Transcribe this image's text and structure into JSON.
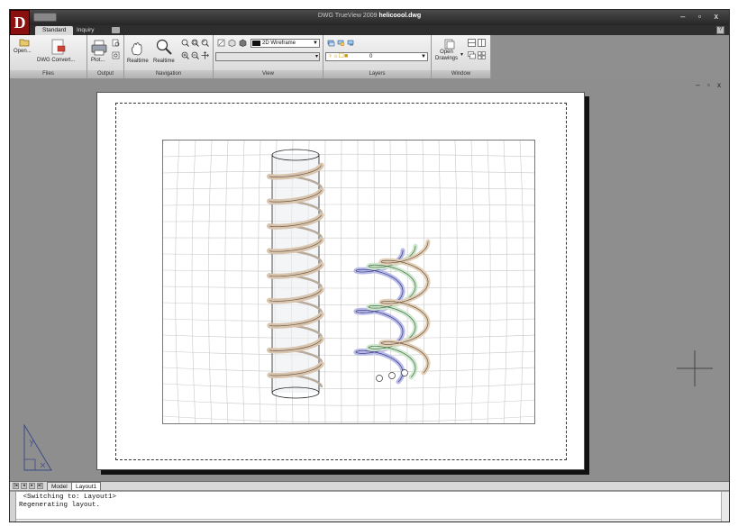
{
  "window": {
    "title_prefix": "DWG TrueView 2009 ",
    "title_file": "helicoool.dwg",
    "app_logo": "D",
    "controls": "– ▫ x"
  },
  "ribbon_tabs": [
    {
      "label": "Standard",
      "active": true
    },
    {
      "label": "Inquiry",
      "active": false
    }
  ],
  "help_label": "?",
  "ribbon": {
    "files": {
      "title": "Files",
      "open_label": "Open...",
      "convert_label": "DWG Convert..."
    },
    "output": {
      "title": "Output",
      "plot_label": "Plot..."
    },
    "navigation": {
      "title": "Navigation",
      "pan_label": "Realtime",
      "zoom_label": "Realtime"
    },
    "view": {
      "title": "View",
      "visual_style": "2D Wireframe"
    },
    "layers": {
      "title": "Layers",
      "current_layer": "0"
    },
    "window": {
      "title": "Window",
      "open_drawings_label": "Open\nDrawings"
    }
  },
  "mdi_controls": "– ▫ x",
  "layout_nav": [
    "|◂",
    "◂",
    "▸",
    "▸|"
  ],
  "layout_tabs": [
    {
      "label": "Model",
      "active": false
    },
    {
      "label": "Layout1",
      "active": true
    }
  ],
  "command_line": {
    "lines": [
      " <Switching to: Layout1>",
      "Regenerating layout."
    ]
  },
  "colors": {
    "titlebar": "#262626",
    "ribbon": "#e8e8e8",
    "canvas": "#8e8e8e",
    "paper": "#ffffff",
    "logo": "#8a1010"
  }
}
